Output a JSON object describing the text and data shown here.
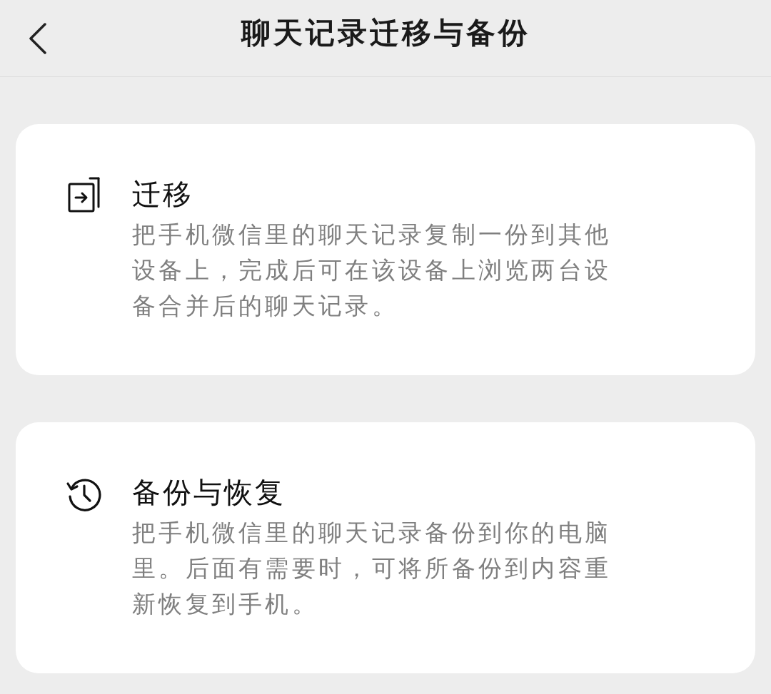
{
  "header": {
    "title": "聊天记录迁移与备份"
  },
  "cards": [
    {
      "kind": "migrate",
      "title": "迁移",
      "description": "把手机微信里的聊天记录复制一份到其他设备上，完成后可在该设备上浏览两台设备合并后的聊天记录。"
    },
    {
      "kind": "backup",
      "title": "备份与恢复",
      "description": "把手机微信里的聊天记录备份到你的电脑里。后面有需要时，可将所备份到内容重新恢复到手机。"
    }
  ]
}
